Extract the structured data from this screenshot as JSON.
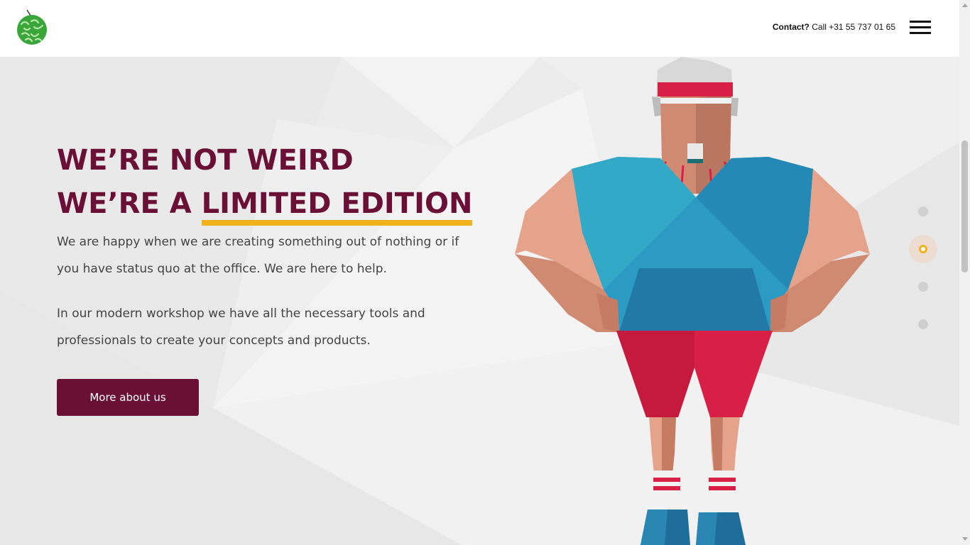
{
  "header": {
    "contact_label": "Contact?",
    "contact_text": "Call +31 55 737 01 65"
  },
  "hero": {
    "headline_line1": "WE’RE NOT WEIRD",
    "headline_line2_prefix": "WE’RE A ",
    "headline_line2_highlight": "LIMITED EDITION",
    "paragraph1": "We are happy when we are creating something out of nothing or if you have status quo at the office. We are here to help.",
    "paragraph2": "In our modern workshop we have all the necessary tools and professionals to create your concepts and products.",
    "button_label": "More about us"
  },
  "slides": {
    "count": 4,
    "active_index": 1
  },
  "colors": {
    "brand": "#6a0f36",
    "accent": "#f2b21c",
    "logo_green": "#3aa63a"
  },
  "icons": [
    "logo-icon",
    "menu-icon"
  ]
}
